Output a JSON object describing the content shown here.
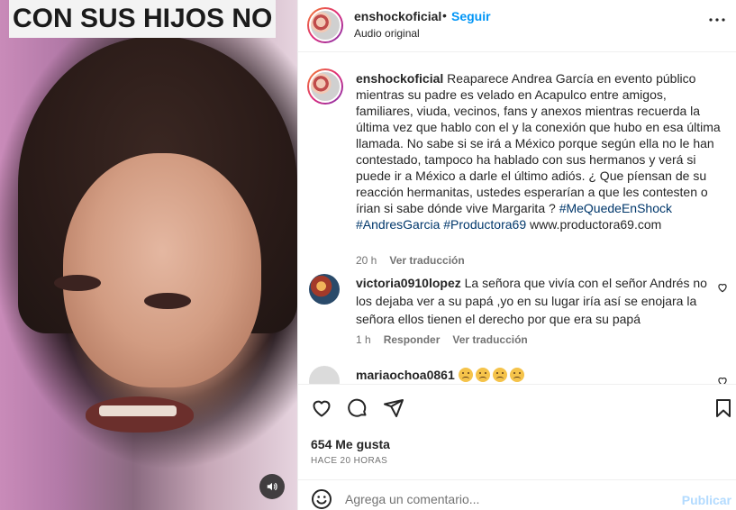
{
  "media": {
    "overlay_text": "CON SUS HIJOS NO",
    "audio_icon": "speaker-icon"
  },
  "header": {
    "username": "enshockoficial",
    "separator": "•",
    "follow_label": "Seguir",
    "subtitle": "Audio original",
    "more_icon": "more-icon"
  },
  "caption": {
    "username": "enshockoficial",
    "text": "Reaparece Andrea García en evento público mientras su padre es velado en Acapulco entre amigos, familiares, viuda, vecinos, fans y anexos mientras recuerda la última vez que hablo con el y la conexión que hubo en esa última llamada. No sabe si se irá a México porque según ella no le han contestado, tampoco ha hablado con sus hermanos y verá si puede ir a México a darle el último adiós. ¿ Que píensan de su reacción hermanitas, ustedes esperarían a que les contesten o írian si sabe dónde vive Margarita ?",
    "hashtags": "#MeQuedeEnShock #AndresGarcia #Productora69",
    "link": "www.productora69.com",
    "time": "20 h",
    "translate_label": "Ver traducción"
  },
  "comments": [
    {
      "username": "victoria0910lopez",
      "text": "La señora que vivía con el señor Andrés no los dejaba ver a su papá ,yo en su lugar iría así se enojara la señora ellos tienen el derecho por que era su papá",
      "time": "1 h",
      "reply_label": "Responder",
      "translate_label": "Ver traducción"
    },
    {
      "username": "mariaochoa0861",
      "text": ""
    }
  ],
  "actions": {
    "likes": "654 Me gusta",
    "posted": "HACE 20 HORAS"
  },
  "composer": {
    "placeholder": "Agrega un comentario...",
    "post_label": "Publicar"
  }
}
